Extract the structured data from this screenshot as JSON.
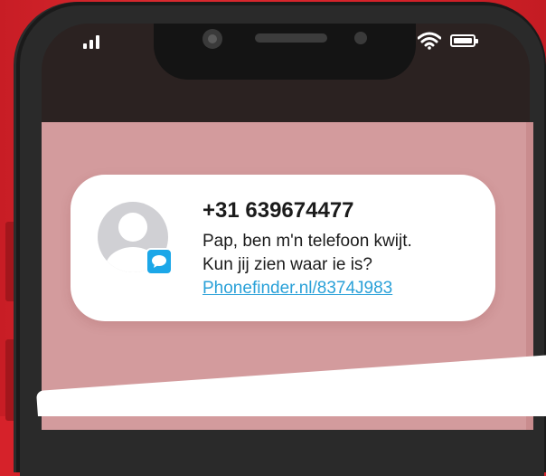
{
  "status_bar": {
    "signal_icon": "signal-bars-icon",
    "wifi_icon": "wifi-icon",
    "battery_icon": "battery-icon"
  },
  "notification": {
    "sender": "+31 639674477",
    "line1": "Pap, ben m'n telefoon kwijt.",
    "line2": "Kun jij zien waar ie is?",
    "link": "Phonefinder.nl/8374J983",
    "avatar_icon": "person-avatar-icon",
    "app_icon": "message-bubble-icon"
  },
  "colors": {
    "background": "#d6222a",
    "screen": "#d39b9d",
    "link": "#2aa1d8",
    "badge": "#1ca7e8"
  }
}
